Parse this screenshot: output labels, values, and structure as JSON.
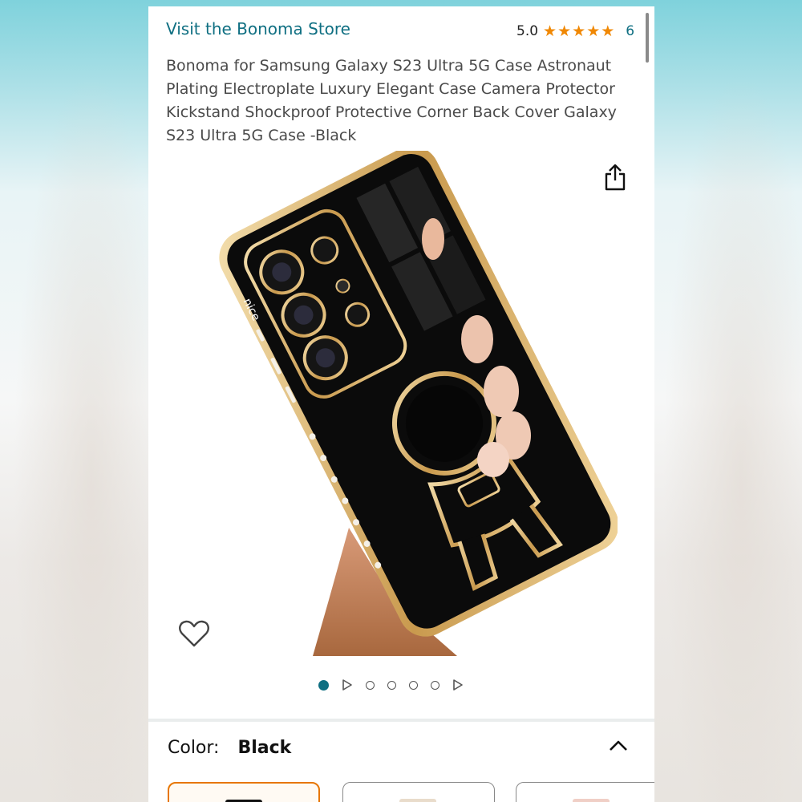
{
  "store": {
    "link_label": "Visit the Bonoma Store"
  },
  "rating": {
    "value": "5.0",
    "stars": 5,
    "max_stars": 5,
    "count": "6",
    "star_color": "#f08804"
  },
  "product": {
    "title": "Bonoma for Samsung Galaxy S23 Ultra 5G Case Astronaut Plating Electroplate Luxury Elegant Case Camera Protector Kickstand Shockproof Protective Corner Back Cover Galaxy S23 Ultra 5G Case -Black",
    "case_text": "nice"
  },
  "icons": {
    "share": "share-icon",
    "wishlist": "heart-outline-icon",
    "collapse": "chevron-up-icon"
  },
  "carousel": {
    "total": 7,
    "active_index": 0,
    "items": [
      "image",
      "video",
      "image",
      "image",
      "image",
      "image",
      "video"
    ]
  },
  "variation": {
    "label": "Color:",
    "selected": "Black",
    "swatches": [
      "Black",
      "Beige",
      "Pink"
    ]
  },
  "colors": {
    "link": "#0f6f82",
    "accent_selected": "#e77600",
    "case_black": "#0b0b0b",
    "plating_gold": "#d7b471"
  }
}
